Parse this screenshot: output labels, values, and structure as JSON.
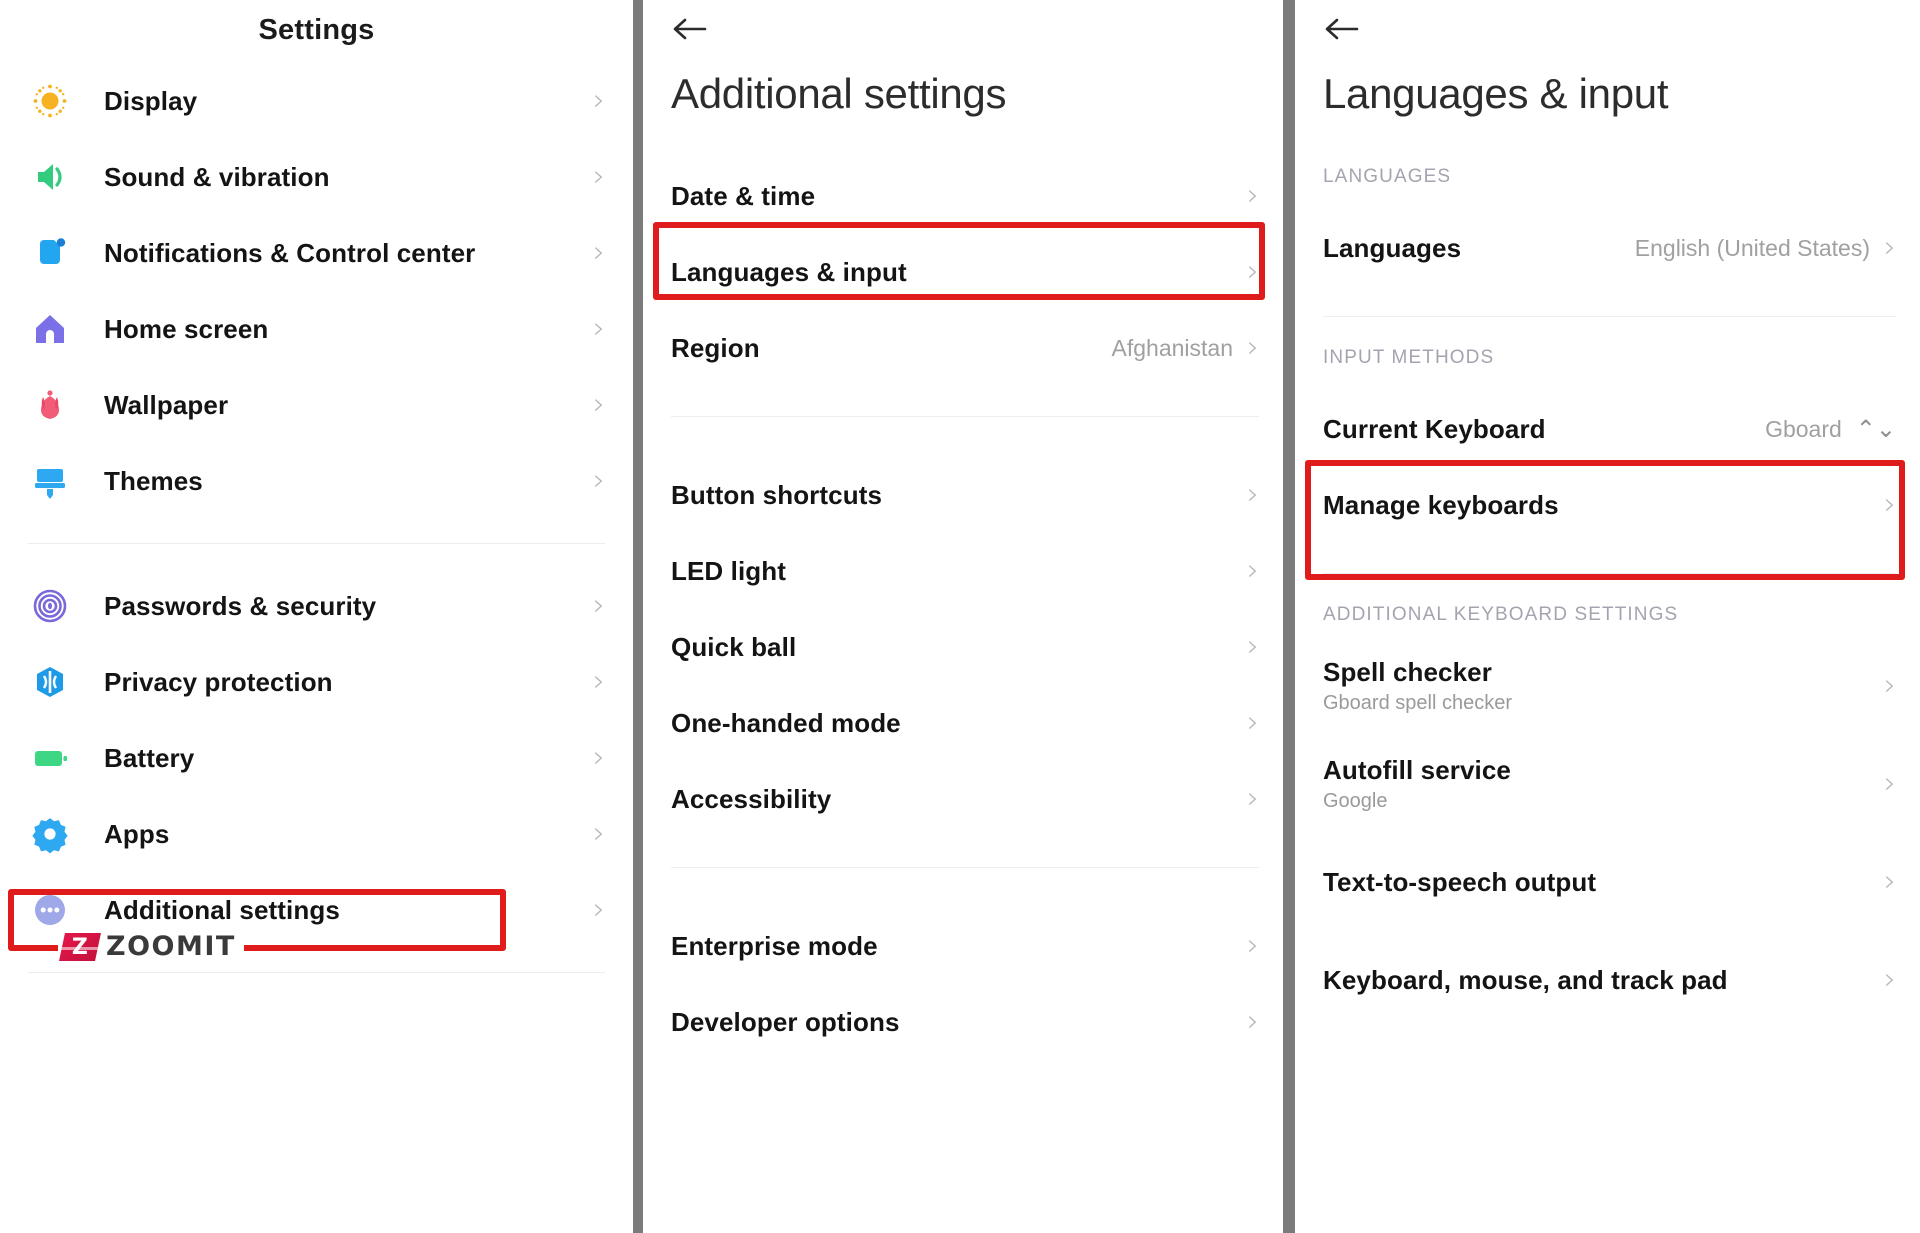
{
  "panel1": {
    "title": "Settings",
    "items": [
      {
        "label": "Display",
        "icon": "brightness-sun-icon",
        "chevron": "›"
      },
      {
        "label": "Sound & vibration",
        "icon": "speaker-volume-icon",
        "chevron": "›"
      },
      {
        "label": "Notifications & Control center",
        "icon": "notification-badge-icon",
        "chevron": "›"
      },
      {
        "label": "Home screen",
        "icon": "home-icon",
        "chevron": "›"
      },
      {
        "label": "Wallpaper",
        "icon": "flower-wallpaper-icon",
        "chevron": "›"
      },
      {
        "label": "Themes",
        "icon": "paint-brush-icon",
        "chevron": "›"
      },
      {
        "label": "Passwords & security",
        "icon": "fingerprint-icon",
        "chevron": "›"
      },
      {
        "label": "Privacy protection",
        "icon": "shield-privacy-icon",
        "chevron": "›"
      },
      {
        "label": "Battery",
        "icon": "battery-icon",
        "chevron": "›"
      },
      {
        "label": "Apps",
        "icon": "gear-apps-icon",
        "chevron": "›"
      },
      {
        "label": "Additional settings",
        "icon": "ellipsis-circle-icon",
        "chevron": "›"
      }
    ],
    "watermark": "ZOOMIT"
  },
  "panel2": {
    "back_icon": "back-arrow-icon",
    "title": "Additional settings",
    "items": [
      {
        "label": "Date & time",
        "value": "",
        "chevron": "›"
      },
      {
        "label": "Languages & input",
        "value": "",
        "chevron": "›"
      },
      {
        "label": "Region",
        "value": "Afghanistan",
        "chevron": "›"
      },
      {
        "label": "Button shortcuts",
        "value": "",
        "chevron": "›"
      },
      {
        "label": "LED light",
        "value": "",
        "chevron": "›"
      },
      {
        "label": "Quick ball",
        "value": "",
        "chevron": "›"
      },
      {
        "label": "One-handed mode",
        "value": "",
        "chevron": "›"
      },
      {
        "label": "Accessibility",
        "value": "",
        "chevron": "›"
      },
      {
        "label": "Enterprise mode",
        "value": "",
        "chevron": "›"
      },
      {
        "label": "Developer options",
        "value": "",
        "chevron": "›"
      }
    ]
  },
  "panel3": {
    "back_icon": "back-arrow-icon",
    "title": "Languages & input",
    "sections": [
      {
        "heading": "LANGUAGES"
      },
      {
        "heading": "INPUT METHODS"
      },
      {
        "heading": "ADDITIONAL KEYBOARD SETTINGS"
      }
    ],
    "languages_row": {
      "label": "Languages",
      "value": "English (United States)",
      "chevron": "›"
    },
    "current_keyboard_row": {
      "label": "Current Keyboard",
      "value": "Gboard",
      "control": "⌃⌄"
    },
    "manage_keyboards_row": {
      "label": "Manage keyboards",
      "chevron": "›"
    },
    "additional": [
      {
        "label": "Spell checker",
        "sub": "Gboard spell checker",
        "chevron": "›"
      },
      {
        "label": "Autofill service",
        "sub": "Google",
        "chevron": "›"
      },
      {
        "label": "Text-to-speech output",
        "sub": "",
        "chevron": "›"
      },
      {
        "label": "Keyboard, mouse, and track pad",
        "sub": "",
        "chevron": "›"
      }
    ]
  },
  "annotations": {
    "highlight_color": "#e01b1b",
    "highlighted_items": [
      "Additional settings",
      "Languages & input",
      "Current Keyboard",
      "Manage keyboards"
    ]
  },
  "colors": {
    "display": "#F6B221",
    "sound": "#33CC7F",
    "notifications": "#22A6F0",
    "home": "#7C70E8",
    "wallpaper": "#F15C77",
    "themes": "#2EA8F0",
    "passwords": "#7B68D8",
    "privacy": "#1E9BE8",
    "battery": "#3CD685",
    "apps": "#2EA8F0",
    "additional": "#9FA8E8",
    "divider": "#7b7b7b"
  }
}
